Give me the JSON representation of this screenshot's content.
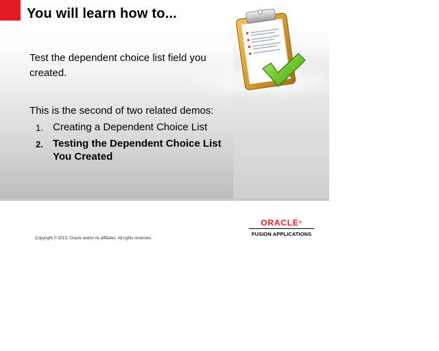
{
  "slide": {
    "title": "You will learn how to...",
    "intro": "Test the dependent choice list field you created.",
    "related_intro": "This is the second of two related demos:",
    "demos": [
      {
        "number": "1.",
        "label": "Creating a Dependent Choice List",
        "current": false
      },
      {
        "number": "2.",
        "label": "Testing the Dependent Choice List You Created",
        "current": true
      }
    ],
    "illustration_icon": "clipboard-checkmark-icon"
  },
  "footer": {
    "copyright": "Copyright © 2013, Oracle and/or its affiliates. All rights reserved.",
    "brand": "ORACLE",
    "brand_suffix": "®",
    "product": "FUSION APPLICATIONS"
  },
  "colors": {
    "accent_red": "#e11b22",
    "check_green": "#6cc42a",
    "clipboard_gold": "#d69b2a"
  }
}
